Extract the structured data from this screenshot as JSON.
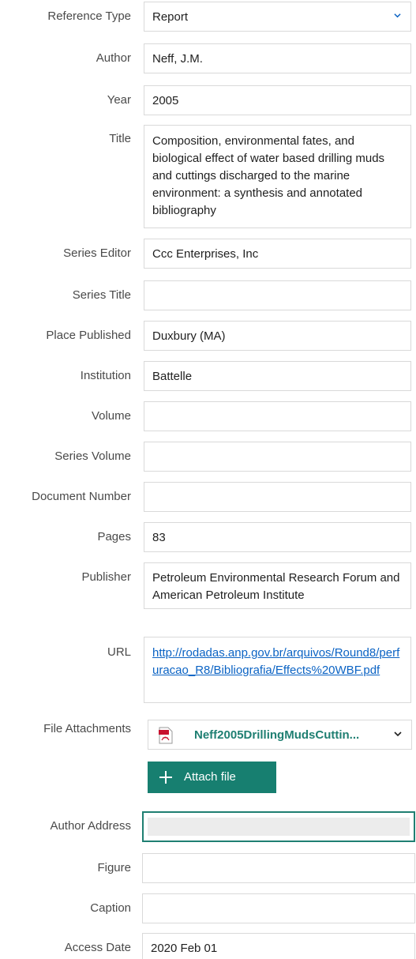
{
  "fields": {
    "reference_type": {
      "label": "Reference Type",
      "value": "Report"
    },
    "author": {
      "label": "Author",
      "value": "Neff, J.M."
    },
    "year": {
      "label": "Year",
      "value": "2005"
    },
    "title": {
      "label": "Title",
      "value": "Composition, environmental fates, and biological effect of water based drilling muds and cuttings discharged to the marine environment: a synthesis and annotated bibliography"
    },
    "series_editor": {
      "label": "Series Editor",
      "value": "Ccc Enterprises, Inc"
    },
    "series_title": {
      "label": "Series Title",
      "value": ""
    },
    "place_published": {
      "label": "Place Published",
      "value": "Duxbury (MA)"
    },
    "institution": {
      "label": "Institution",
      "value": "Battelle"
    },
    "volume": {
      "label": "Volume",
      "value": ""
    },
    "series_volume": {
      "label": "Series Volume",
      "value": ""
    },
    "document_number": {
      "label": "Document Number",
      "value": ""
    },
    "pages": {
      "label": "Pages",
      "value": "83"
    },
    "publisher": {
      "label": "Publisher",
      "value": "Petroleum Environmental Research Forum and American Petroleum Institute"
    },
    "url": {
      "label": "URL",
      "value": "http://rodadas.anp.gov.br/arquivos/Round8/perfuracao_R8/Bibliografia/Effects%20WBF.pdf"
    },
    "file_attachments": {
      "label": "File Attachments",
      "value": "Neff2005DrillingMudsCuttin...",
      "button": "Attach file"
    },
    "author_address": {
      "label": "Author Address",
      "value": ""
    },
    "figure": {
      "label": "Figure",
      "value": ""
    },
    "caption": {
      "label": "Caption",
      "value": ""
    },
    "access_date": {
      "label": "Access Date",
      "value": "2020 Feb 01"
    }
  },
  "icons": {
    "dropdown": "chevron-down-icon",
    "attachment": "pdf-file-icon",
    "attach": "plus-icon"
  },
  "colors": {
    "accent": "#177f70",
    "link": "#0b63c4",
    "border": "#d9d9d9",
    "label": "#4a4a4a"
  }
}
